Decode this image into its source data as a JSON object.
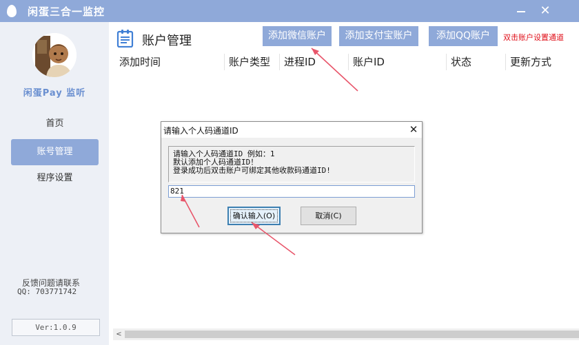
{
  "window": {
    "title": "闲蛋三合一监控",
    "close_glyph": "✕"
  },
  "sidebar": {
    "brand": "闲蛋Pay 监听",
    "items": [
      {
        "label": "首页",
        "active": false
      },
      {
        "label": "账号管理",
        "active": true
      },
      {
        "label": "程序设置",
        "active": false
      }
    ],
    "feedback": "反馈问题请联系",
    "qq": "QQ: 703771742",
    "version": "Ver:1.0.9"
  },
  "main": {
    "title": "账户管理",
    "buttons": {
      "wechat": "添加微信账户",
      "alipay": "添加支付宝账户",
      "qq": "添加QQ账户"
    },
    "hint": "双击账户设置通道",
    "columns": [
      "添加时间",
      "账户类型",
      "进程ID",
      "账户ID",
      "状态",
      "更新方式"
    ]
  },
  "dialog": {
    "title": "请输入个人码通道ID",
    "lines": [
      "请输入个人码通道ID  例如：1",
      "默认添加个人码通道ID！",
      "登录成功后双击账户可绑定其他收款码通道ID!"
    ],
    "input_value": "821",
    "ok_label": "确认输入(O)",
    "cancel_label": "取消(C)"
  },
  "colors": {
    "accent": "#8fa9d9",
    "hint_red": "#e0101a",
    "arrow": "#e8556a"
  },
  "icons": {
    "app": "egg-icon",
    "page": "clipboard-list-icon",
    "minimize": "minimize-icon",
    "close": "close-icon"
  }
}
